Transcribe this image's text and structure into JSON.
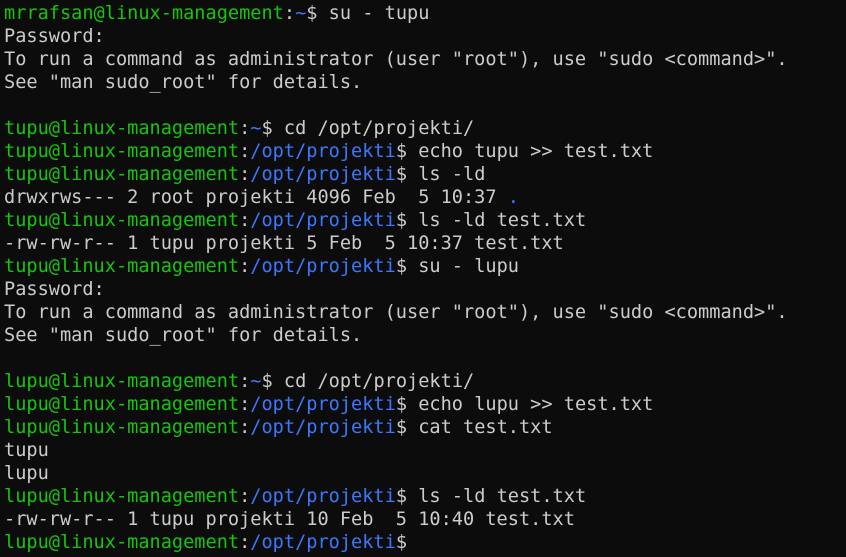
{
  "colors": {
    "background": "#0c0c0c",
    "text": "#cccccc",
    "prompt_user_host": "#16c60c",
    "prompt_path": "#3b78ff"
  },
  "lines": [
    {
      "type": "prompt",
      "user_host": "mrrafsan@linux-management",
      "path": "~",
      "command": " su - tupu"
    },
    {
      "type": "output",
      "text": "Password:"
    },
    {
      "type": "output",
      "text": "To run a command as administrator (user \"root\"), use \"sudo <command>\"."
    },
    {
      "type": "output",
      "text": "See \"man sudo_root\" for details."
    },
    {
      "type": "blank",
      "text": ""
    },
    {
      "type": "prompt",
      "user_host": "tupu@linux-management",
      "path": "~",
      "command": " cd /opt/projekti/"
    },
    {
      "type": "prompt",
      "user_host": "tupu@linux-management",
      "path": "/opt/projekti",
      "command": " echo tupu >> test.txt"
    },
    {
      "type": "prompt",
      "user_host": "tupu@linux-management",
      "path": "/opt/projekti",
      "command": " ls -ld"
    },
    {
      "type": "output_dir",
      "text": "drwxrws--- 2 root projekti 4096 Feb  5 10:37 ",
      "dir": "."
    },
    {
      "type": "prompt",
      "user_host": "tupu@linux-management",
      "path": "/opt/projekti",
      "command": " ls -ld test.txt"
    },
    {
      "type": "output",
      "text": "-rw-rw-r-- 1 tupu projekti 5 Feb  5 10:37 test.txt"
    },
    {
      "type": "prompt",
      "user_host": "tupu@linux-management",
      "path": "/opt/projekti",
      "command": " su - lupu"
    },
    {
      "type": "output",
      "text": "Password:"
    },
    {
      "type": "output",
      "text": "To run a command as administrator (user \"root\"), use \"sudo <command>\"."
    },
    {
      "type": "output",
      "text": "See \"man sudo_root\" for details."
    },
    {
      "type": "blank",
      "text": ""
    },
    {
      "type": "prompt",
      "user_host": "lupu@linux-management",
      "path": "~",
      "command": " cd /opt/projekti/"
    },
    {
      "type": "prompt",
      "user_host": "lupu@linux-management",
      "path": "/opt/projekti",
      "command": " echo lupu >> test.txt"
    },
    {
      "type": "prompt",
      "user_host": "lupu@linux-management",
      "path": "/opt/projekti",
      "command": " cat test.txt"
    },
    {
      "type": "output",
      "text": "tupu"
    },
    {
      "type": "output",
      "text": "lupu"
    },
    {
      "type": "prompt",
      "user_host": "lupu@linux-management",
      "path": "/opt/projekti",
      "command": " ls -ld test.txt"
    },
    {
      "type": "output",
      "text": "-rw-rw-r-- 1 tupu projekti 10 Feb  5 10:40 test.txt"
    },
    {
      "type": "prompt",
      "user_host": "lupu@linux-management",
      "path": "/opt/projekti",
      "command": ""
    }
  ]
}
